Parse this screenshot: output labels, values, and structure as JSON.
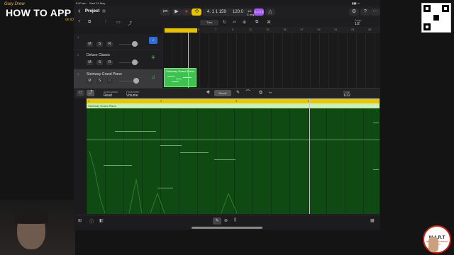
{
  "overlay": {
    "brand_small": "Gary Drew",
    "brand_title": "HOW TO APP",
    "brand_sub": "on iOS",
    "wart_title": "W.A.R.T",
    "wart_sub": "WE ARE RECORDING TODAY"
  },
  "status_bar": {
    "time": "8:00 am",
    "date": "Wed 24 May"
  },
  "header": {
    "back": "‹",
    "project_title": "Project",
    "lcd_position": "4. 1  1 159",
    "tempo": "120.0",
    "signature": "4/4",
    "key": "C maj",
    "count_in": "1 2 3 4",
    "record_arm": "1 2 3 4"
  },
  "toolbar2": {
    "trim_label": "Trim",
    "snap_label": "Snap",
    "snap_value": "1/2"
  },
  "tracks": [
    {
      "num": "1",
      "name": "",
      "icon": "guitar-icon",
      "m": "M",
      "s": "S",
      "r": "R"
    },
    {
      "num": "2",
      "name": "Deluxe Classic",
      "icon": "organ-icon",
      "m": "M",
      "s": "S",
      "r": "R"
    },
    {
      "num": "3",
      "name": "Steinway Grand Piano",
      "icon": "piano-icon",
      "m": "M",
      "s": "S",
      "r": "R"
    }
  ],
  "ruler_marks": [
    "1",
    "3",
    "5",
    "7",
    "9",
    "11",
    "13",
    "15",
    "17",
    "19",
    "21",
    "23",
    "25"
  ],
  "arrange_region_label": "Steinway Grand Piano",
  "editor": {
    "automation_label": "Automation",
    "automation_value": "Read",
    "parameter_label": "Parameter",
    "parameter_value": "Volume",
    "pencil_label": "Pencil",
    "snap_label": "Snap",
    "snap_value": "1/32",
    "region_label": "Steinway Grand Piano",
    "ruler_marks": [
      "1",
      "2",
      "3",
      "4"
    ]
  },
  "colors": {
    "accent": "#e6c200",
    "region": "#3fc152",
    "record": "#e0302a",
    "lcd_count": "#a45cf0"
  }
}
